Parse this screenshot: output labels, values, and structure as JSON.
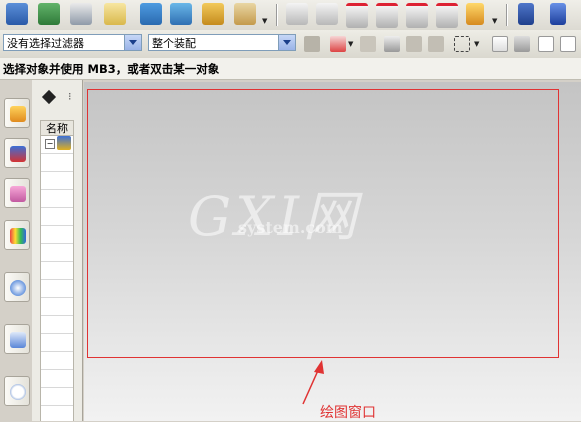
{
  "toolbar": {
    "icons": [
      "assembly-navigator-icon",
      "assembly-icon",
      "component-icon",
      "key-icon",
      "add-component-icon",
      "mate-icon",
      "replace-component-icon",
      "wave-icon",
      "tube-icon",
      "cut-a-icon",
      "cut-b-icon",
      "cut-c-icon",
      "cut-d-icon",
      "cut-e-icon",
      "measure-icon",
      "layer-icon",
      "pen-icon"
    ]
  },
  "filter_bar": {
    "filter_value": "没有选择过滤器",
    "scope_value": "整个装配"
  },
  "status": {
    "prompt": "选择对象并使用 MB3，或者双击某一对象"
  },
  "navigator": {
    "column_header": "名称"
  },
  "annotation": {
    "label": "绘图窗口"
  },
  "watermark": {
    "main": "GXI网",
    "sub": "system.com"
  }
}
